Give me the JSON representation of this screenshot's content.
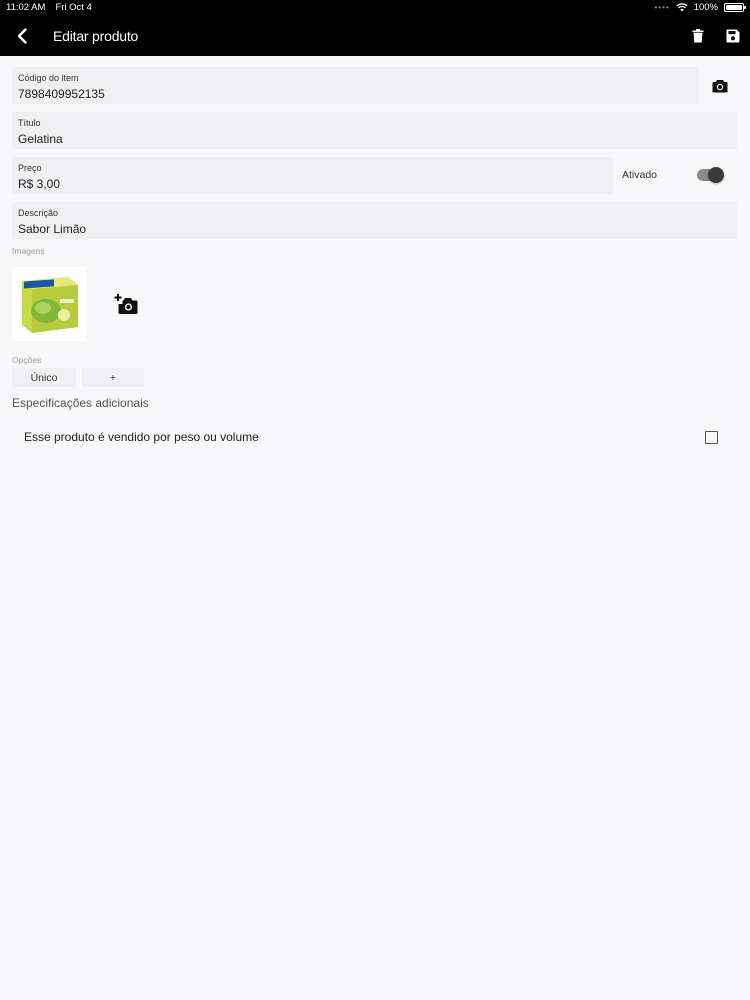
{
  "status": {
    "time": "11:02 AM",
    "date": "Fri Oct 4",
    "battery": "100%"
  },
  "header": {
    "title": "Editar produto"
  },
  "fields": {
    "code": {
      "label": "Código do item",
      "value": "7898409952135"
    },
    "title": {
      "label": "Título",
      "value": "Gelatina"
    },
    "price": {
      "label": "Preço",
      "value": "R$ 3,00"
    },
    "description": {
      "label": "Descrição",
      "value": "Sabor Limão"
    }
  },
  "toggle": {
    "label": "Ativado",
    "on": true
  },
  "images": {
    "label": "Imagens"
  },
  "options": {
    "label": "Opções",
    "chips": [
      "Único",
      "+"
    ]
  },
  "extra": {
    "title": "Especificações adicionais",
    "weight_label": "Esse produto é vendido por peso ou volume",
    "checked": false
  },
  "colors": {
    "bar": "#000000",
    "background": "#f7f6f8",
    "field": "#efeef1"
  }
}
